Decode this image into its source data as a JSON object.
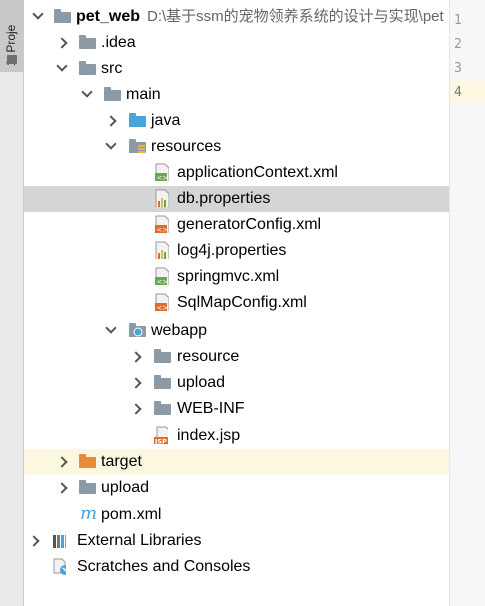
{
  "side_panel": {
    "label": "1: Proje"
  },
  "tree": {
    "root": {
      "name": "pet_web",
      "path": "D:\\基于ssm的宠物领养系统的设计与实现\\pet"
    },
    "idea": ".idea",
    "src": "src",
    "main": "main",
    "java": "java",
    "resources": "resources",
    "files_resources": [
      "applicationContext.xml",
      "db.properties",
      "generatorConfig.xml",
      "log4j.properties",
      "springmvc.xml",
      "SqlMapConfig.xml"
    ],
    "webapp": "webapp",
    "webapp_children": [
      "resource",
      "upload",
      "WEB-INF"
    ],
    "index_jsp": "index.jsp",
    "target": "target",
    "upload": "upload",
    "pom": "pom.xml",
    "external_libraries": "External Libraries",
    "scratches": "Scratches and Consoles"
  },
  "gutter": {
    "line_numbers": [
      "1",
      "2",
      "3",
      "4"
    ]
  }
}
